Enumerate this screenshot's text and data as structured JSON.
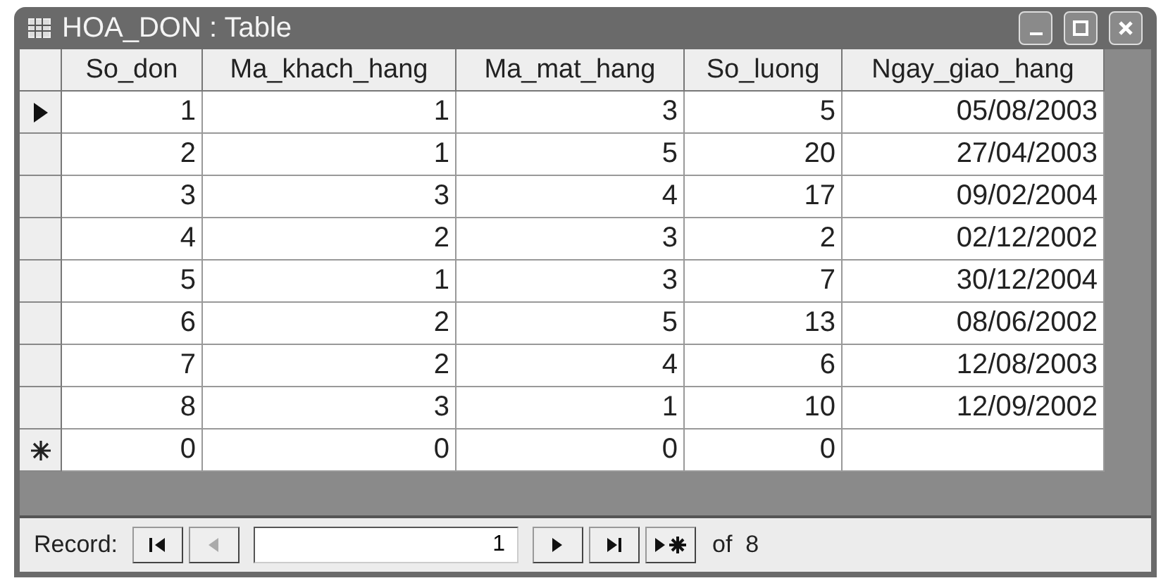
{
  "window": {
    "title": "HOA_DON : Table"
  },
  "columns": [
    "So_don",
    "Ma_khach_hang",
    "Ma_mat_hang",
    "So_luong",
    "Ngay_giao_hang"
  ],
  "rows": [
    {
      "kind": "record",
      "current": true,
      "cells": [
        "1",
        "1",
        "3",
        "5",
        "05/08/2003"
      ]
    },
    {
      "kind": "record",
      "current": false,
      "cells": [
        "2",
        "1",
        "5",
        "20",
        "27/04/2003"
      ]
    },
    {
      "kind": "record",
      "current": false,
      "cells": [
        "3",
        "3",
        "4",
        "17",
        "09/02/2004"
      ]
    },
    {
      "kind": "record",
      "current": false,
      "cells": [
        "4",
        "2",
        "3",
        "2",
        "02/12/2002"
      ]
    },
    {
      "kind": "record",
      "current": false,
      "cells": [
        "5",
        "1",
        "3",
        "7",
        "30/12/2004"
      ]
    },
    {
      "kind": "record",
      "current": false,
      "cells": [
        "6",
        "2",
        "5",
        "13",
        "08/06/2002"
      ]
    },
    {
      "kind": "record",
      "current": false,
      "cells": [
        "7",
        "2",
        "4",
        "6",
        "12/08/2003"
      ]
    },
    {
      "kind": "record",
      "current": false,
      "cells": [
        "8",
        "3",
        "1",
        "10",
        "12/09/2002"
      ]
    },
    {
      "kind": "new",
      "current": false,
      "cells": [
        "0",
        "0",
        "0",
        "0",
        ""
      ]
    }
  ],
  "navigation": {
    "label": "Record:",
    "value": "1",
    "total": "of  8",
    "buttons": [
      {
        "kind": "first",
        "disabled": false
      },
      {
        "kind": "prev",
        "disabled": true
      },
      {
        "kind": "next",
        "disabled": false
      },
      {
        "kind": "last",
        "disabled": false
      },
      {
        "kind": "new",
        "disabled": false
      }
    ]
  }
}
